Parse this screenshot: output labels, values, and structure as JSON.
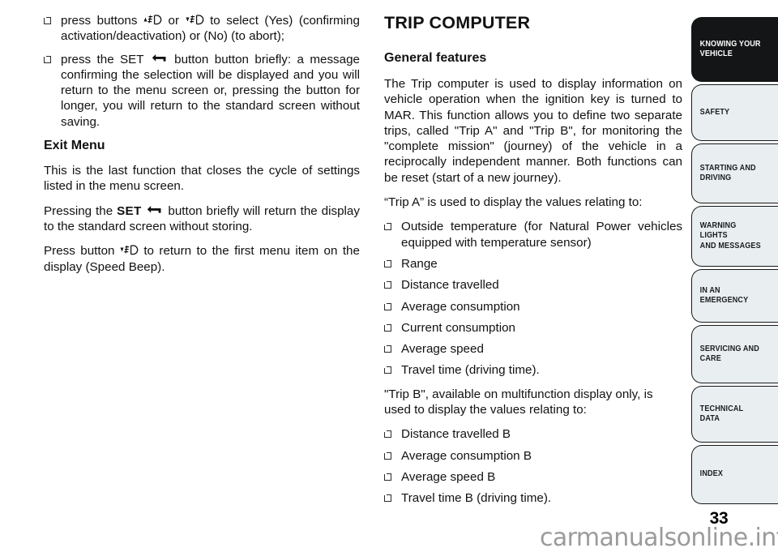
{
  "document": {
    "page_number": "33",
    "watermark": "carmanualsonline.info"
  },
  "left_column": {
    "bullets_top": [
      {
        "text_before": "press buttons",
        "glyph_1": "up-arrow-headlight-button",
        "text_middle": "or",
        "glyph_2": "down-arrow-headlight-button",
        "text_after": "to select (Yes) (confirming activation/deactivation) or (No) (to abort);"
      },
      {
        "text_before": "press the SET",
        "glyph_1": "return-arrow-button",
        "text_after": "button button briefly: a message confirming the selection will be displayed and you will return to the menu screen or, pressing the button for longer, you will return to the standard screen without saving."
      }
    ],
    "exit_menu": {
      "heading": "Exit Menu",
      "paragraph_1": "This is the last function that closes the cycle of settings listed in the menu screen.",
      "paragraph_2": {
        "text_before": "Pressing the",
        "bold_word": "SET",
        "glyph": "return-arrow-button",
        "text_after": "button briefly will return the display to the standard screen without storing."
      },
      "paragraph_3": {
        "text_before": "Press button",
        "glyph": "down-arrow-headlight-button",
        "text_after": "to return to the first menu item on the display (Speed Beep)."
      }
    }
  },
  "right_column": {
    "title": "TRIP COMPUTER",
    "section_heading": "General features",
    "intro_paragraph": "The Trip computer is used to display information on vehicle operation when the ignition key is turned to MAR. This function allows you to define two separate trips, called \"Trip A\" and \"Trip B\", for monitoring the \"complete mission\" (journey) of the vehicle in a reciprocally independent manner. Both functions can be reset (start of a new journey).",
    "trip_a_lead": "“Trip A” is used to display the values relating to:",
    "trip_a_items": [
      "Outside temperature (for Natural Power vehicles equipped with temperature sensor)",
      "Range",
      "Distance travelled",
      "Average consumption",
      "Current consumption",
      "Average speed",
      "Travel time (driving time)."
    ],
    "trip_b_lead": "\"Trip B\", available on multifunction display only, is used to display the values relating to:",
    "trip_b_items": [
      "Distance travelled B",
      "Average consumption B",
      "Average speed B",
      "Travel time B (driving time)."
    ]
  },
  "tab_rail": {
    "active_index": 0,
    "tabs": [
      {
        "label": "KNOWING YOUR\nVEHICLE",
        "active": true
      },
      {
        "label": "SAFETY",
        "active": false
      },
      {
        "label": "STARTING AND\nDRIVING",
        "active": false
      },
      {
        "label": "WARNING LIGHTS\nAND MESSAGES",
        "active": false
      },
      {
        "label": "IN AN EMERGENCY",
        "active": false
      },
      {
        "label": "SERVICING AND\nCARE",
        "active": false
      },
      {
        "label": "TECHNICAL DATA",
        "active": false
      },
      {
        "label": "INDEX",
        "active": false
      }
    ]
  },
  "colors": {
    "active_tab_bg": "#131516",
    "inactive_tab_bg": "#e9eef0",
    "tab_border": "#16181a",
    "text": "#111111",
    "watermark": "#9b9b9b"
  }
}
